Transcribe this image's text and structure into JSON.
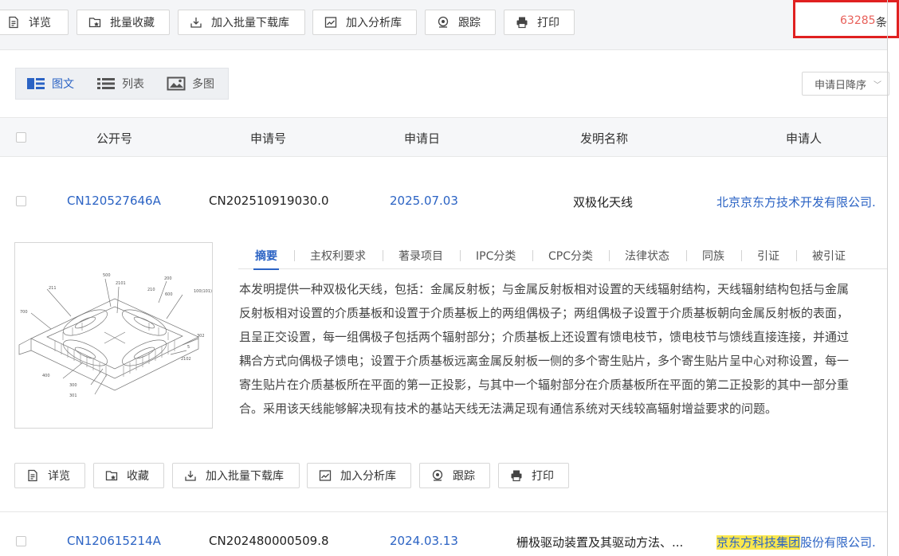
{
  "toolbar": {
    "detail": "详览",
    "batch_favorite": "批量收藏",
    "add_batch_download": "加入批量下载库",
    "add_analysis": "加入分析库",
    "track": "跟踪",
    "print": "打印"
  },
  "result_count": {
    "value": "63285",
    "unit": "条"
  },
  "view_tabs": {
    "graphic": "图文",
    "list": "列表",
    "multi_image": "多图"
  },
  "sort": {
    "label": "申请日降序"
  },
  "table": {
    "headers": {
      "pub_no": "公开号",
      "app_no": "申请号",
      "app_date": "申请日",
      "title": "发明名称",
      "applicant": "申请人"
    }
  },
  "records": [
    {
      "pub_no": "CN120527646A",
      "app_no": "CN202510919030.0",
      "app_date": "2025.07.03",
      "title": "双极化天线",
      "applicant": "北京京东方技术开发有限公司.",
      "figure_labels": [
        "500",
        "2101",
        "200",
        "211",
        "210",
        "600",
        "100(101)",
        "700",
        "302",
        "5",
        "2102",
        "400",
        "300",
        "301"
      ],
      "tabs": [
        "摘要",
        "主权利要求",
        "著录项目",
        "IPC分类",
        "CPC分类",
        "法律状态",
        "同族",
        "引证",
        "被引证"
      ],
      "abstract_lines": [
        "本发明提供一种双极化天线，包括：金属反射板；与金属反射板相对设置的天线辐射结构，天线辐射结构包括与金属",
        "反射板相对设置的介质基板和设置于介质基板上的两组偶极子；两组偶极子设置于介质基板朝向金属反射板的表面，",
        "且呈正交设置，每一组偶极子包括两个辐射部分；介质基板上还设置有馈电枝节，馈电枝节与馈线直接连接，并通过",
        "耦合方式向偶极子馈电；设置于介质基板远离金属反射板一侧的多个寄生贴片，多个寄生贴片呈中心对称设置，每一",
        "寄生贴片在介质基板所在平面的第一正投影，与其中一个辐射部分在介质基板所在平面的第二正投影的其中一部分重",
        "合。采用该天线能够解决现有技术的基站天线无法满足现有通信系统对天线较高辐射增益要求的问题。"
      ],
      "actions": {
        "detail": "详览",
        "favorite": "收藏",
        "add_batch_download": "加入批量下载库",
        "add_analysis": "加入分析库",
        "track": "跟踪",
        "print": "打印"
      }
    },
    {
      "pub_no": "CN120615214A",
      "app_no": "CN202480000509.8",
      "app_date": "2024.03.13",
      "title": "栅极驱动装置及其驱动方法、...",
      "applicant_highlight": "京东方科技集团",
      "applicant_rest": "股份有限公司."
    }
  ],
  "colors": {
    "link": "#2b63c4",
    "count": "#e8605a",
    "highlight": "#fbe74d",
    "box": "#e02020"
  }
}
